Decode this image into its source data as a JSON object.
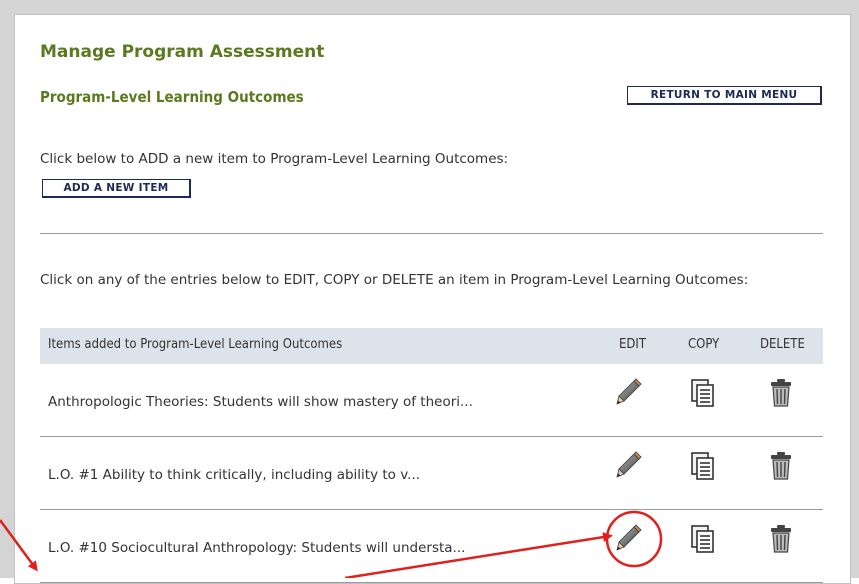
{
  "page": {
    "title": "Manage Program Assessment",
    "subtitle": "Program-Level Learning Outcomes",
    "return_button": "RETURN TO MAIN MENU",
    "add_instruction": "Click below to ADD a new item to Program-Level Learning Outcomes:",
    "add_button": "ADD A NEW ITEM",
    "edit_instruction": "Click on any of the entries below to EDIT, COPY or DELETE an item in Program-Level Learning Outcomes:"
  },
  "table": {
    "headers": {
      "items": "Items added to Program-Level Learning Outcomes",
      "edit": "EDIT",
      "copy": "COPY",
      "delete": "DELETE"
    },
    "rows": [
      {
        "text": "Anthropologic Theories: Students will show mastery of theori..."
      },
      {
        "text": "L.O. #1 Ability to think critically, including ability to v..."
      },
      {
        "text": "L.O. #10 Sociocultural Anthropology: Students will understa..."
      }
    ]
  },
  "icons": {
    "edit": "pencil-icon",
    "copy": "copy-icon",
    "delete": "trash-icon"
  },
  "colors": {
    "heading": "#5b7a1f",
    "button_text": "#1c2a55",
    "header_row": "#dde3ea",
    "annotation": "#e0201b"
  }
}
